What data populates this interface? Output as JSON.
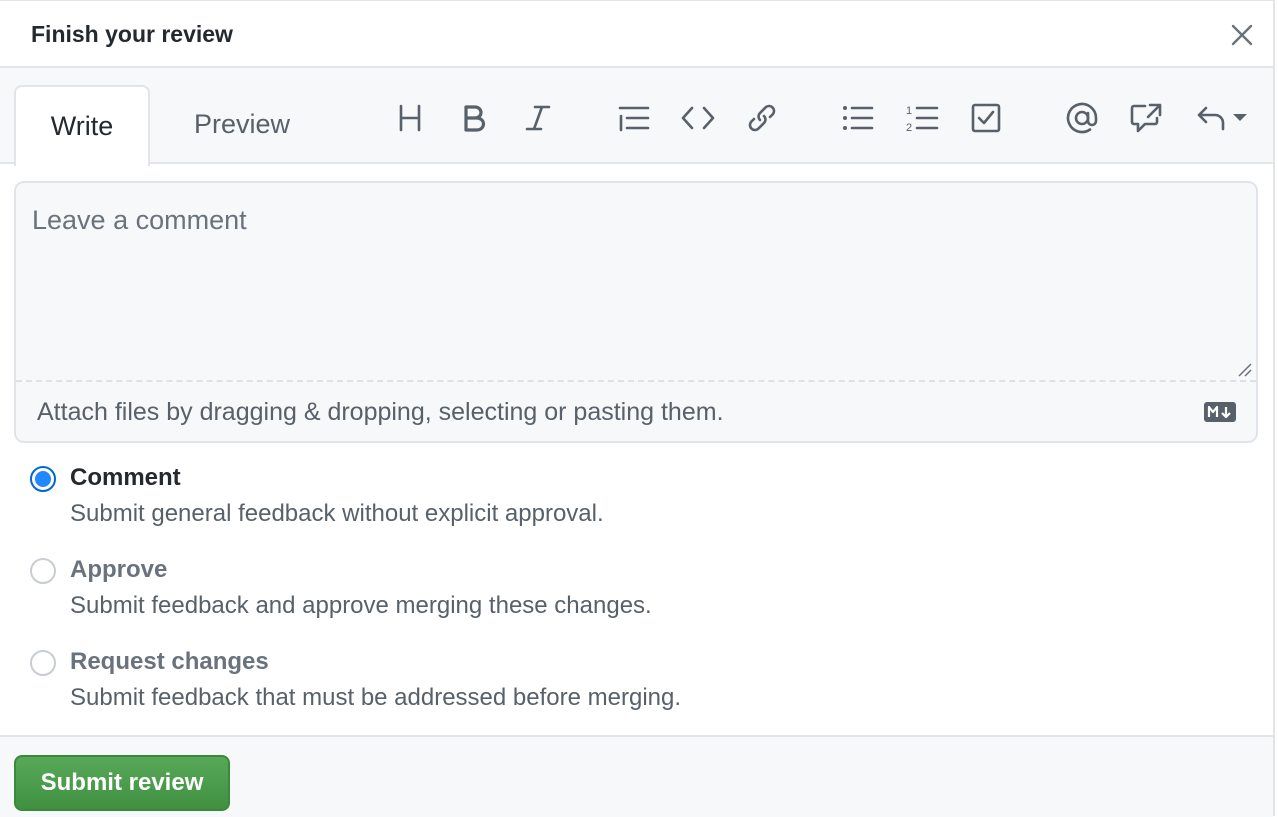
{
  "dialog": {
    "title": "Finish your review",
    "close_icon": "close-icon"
  },
  "tabs": [
    {
      "label": "Write",
      "active": true
    },
    {
      "label": "Preview",
      "active": false
    }
  ],
  "toolbar": {
    "icons": [
      "heading-icon",
      "bold-icon",
      "italic-icon",
      "quote-icon",
      "code-icon",
      "link-icon",
      "bulleted-list-icon",
      "numbered-list-icon",
      "task-list-icon",
      "mention-icon",
      "cross-reference-icon",
      "saved-replies-icon"
    ]
  },
  "editor": {
    "placeholder": "Leave a comment",
    "value": "",
    "attach_text": "Attach files by dragging & dropping, selecting or pasting them.",
    "markdown_icon": "markdown-icon"
  },
  "review_options": [
    {
      "label": "Comment",
      "description": "Submit general feedback without explicit approval.",
      "checked": true
    },
    {
      "label": "Approve",
      "description": "Submit feedback and approve merging these changes.",
      "checked": false
    },
    {
      "label": "Request changes",
      "description": "Submit feedback that must be addressed before merging.",
      "checked": false
    }
  ],
  "footer": {
    "submit_label": "Submit review"
  },
  "colors": {
    "accent_blue": "#0366d6",
    "submit_green": "#4a9c4c",
    "border": "#e1e4e8",
    "panel_bg": "#f6f8fa"
  }
}
